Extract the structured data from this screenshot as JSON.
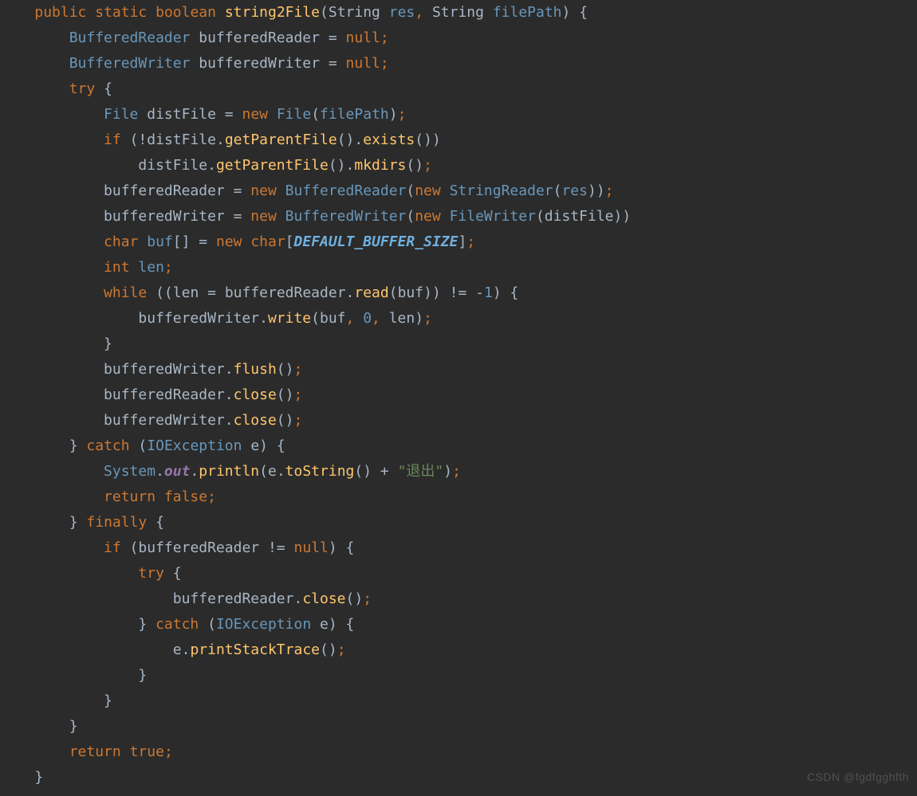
{
  "watermark": "CSDN @fgdfgghfth",
  "code": {
    "kw": {
      "public": "public",
      "static": "static",
      "boolean": "boolean",
      "try": "try",
      "if": "if",
      "new": "new",
      "char": "char",
      "int": "int",
      "while": "while",
      "catch": "catch",
      "return": "return",
      "false": "false",
      "true": "true",
      "finally": "finally",
      "null": "null"
    },
    "types": {
      "String": "String",
      "BufferedReader": "BufferedReader",
      "BufferedWriter": "BufferedWriter",
      "File": "File",
      "StringReader": "StringReader",
      "FileWriter": "FileWriter",
      "IOException": "IOException",
      "System": "System"
    },
    "methods": {
      "string2File": "string2File",
      "getParentFile": "getParentFile",
      "exists": "exists",
      "mkdirs": "mkdirs",
      "read": "read",
      "write": "write",
      "flush": "flush",
      "close": "close",
      "toString": "toString",
      "println": "println",
      "printStackTrace": "printStackTrace"
    },
    "ids": {
      "res": "res",
      "filePath": "filePath",
      "bufferedReader": "bufferedReader",
      "bufferedWriter": "bufferedWriter",
      "distFile": "distFile",
      "buf": "buf",
      "len": "len",
      "e": "e",
      "out": "out"
    },
    "consts": {
      "DEFAULT_BUFFER_SIZE": "DEFAULT_BUFFER_SIZE"
    },
    "nums": {
      "zero": "0",
      "minus1": "-1",
      "neg1": "1"
    },
    "strings": {
      "exit": "\"退出\""
    },
    "punct": {
      "lbrace": "{",
      "rbrace": "}",
      "lparen": "(",
      "rparen": ")",
      "lbrack": "[",
      "rbrack": "]",
      "semi": ";",
      "comma": ",",
      "dot": ".",
      "eq": "=",
      "bang": "!",
      "neq": "!=",
      "plus": "+",
      "minus": "-"
    }
  }
}
